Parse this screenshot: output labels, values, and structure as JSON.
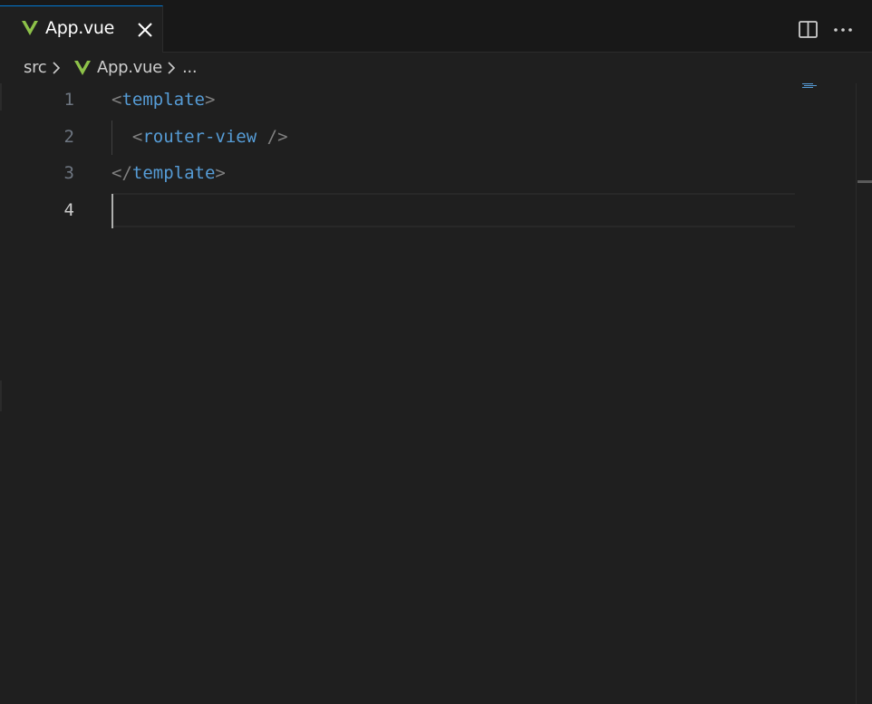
{
  "tab": {
    "label": "App.vue",
    "icon": "vue-icon",
    "close_icon": "close-icon",
    "accent_color": "#0078d4",
    "vue_color": "#8dc149"
  },
  "tab_actions": {
    "split_icon": "split-editor-icon",
    "more_icon": "more-actions-icon"
  },
  "breadcrumb": {
    "folder": "src",
    "file": "App.vue",
    "symbol": "..."
  },
  "code_lines": [
    {
      "number": "1",
      "open": "<",
      "tag": "template",
      "close": ">"
    },
    {
      "number": "2",
      "indent": "  ",
      "open": "<",
      "tag": "router-view",
      "close": " />"
    },
    {
      "number": "3",
      "open": "</",
      "tag": "template",
      "close": ">"
    },
    {
      "number": "4"
    }
  ],
  "colors": {
    "background": "#1f1f1f",
    "tag": "#569cd6",
    "bracket": "#808080",
    "line_number": "#6e7681",
    "active_line_number": "#cccccc"
  }
}
